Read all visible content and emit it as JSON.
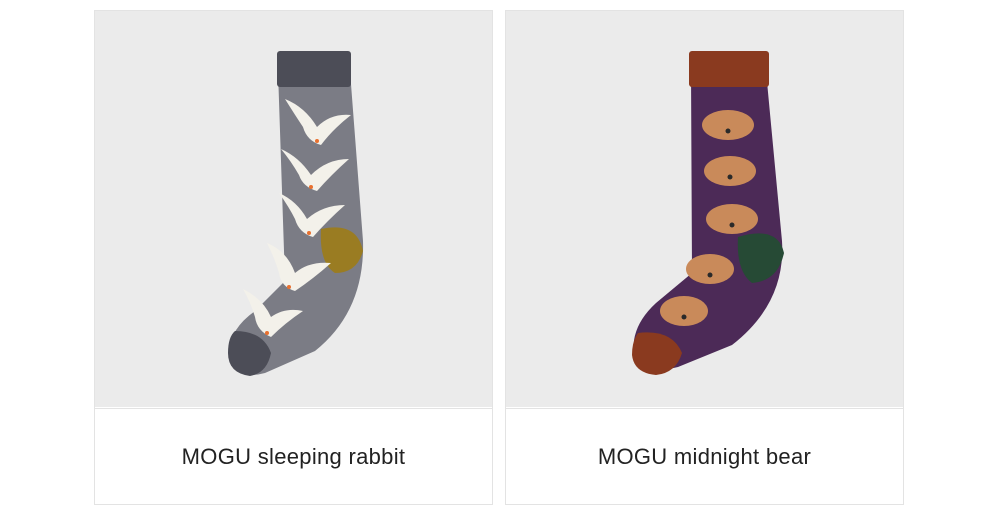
{
  "products": [
    {
      "title": "MOGU sleeping rabbit",
      "sock_colors": {
        "body": "#7b7c85",
        "cuff": "#4c4d57",
        "heel": "#9a7c22",
        "toe": "#4c4d57"
      }
    },
    {
      "title": "MOGU midnight bear",
      "sock_colors": {
        "body": "#4c2a57",
        "cuff": "#8a3a1f",
        "heel": "#264a35",
        "toe": "#8a3a1f"
      }
    }
  ]
}
